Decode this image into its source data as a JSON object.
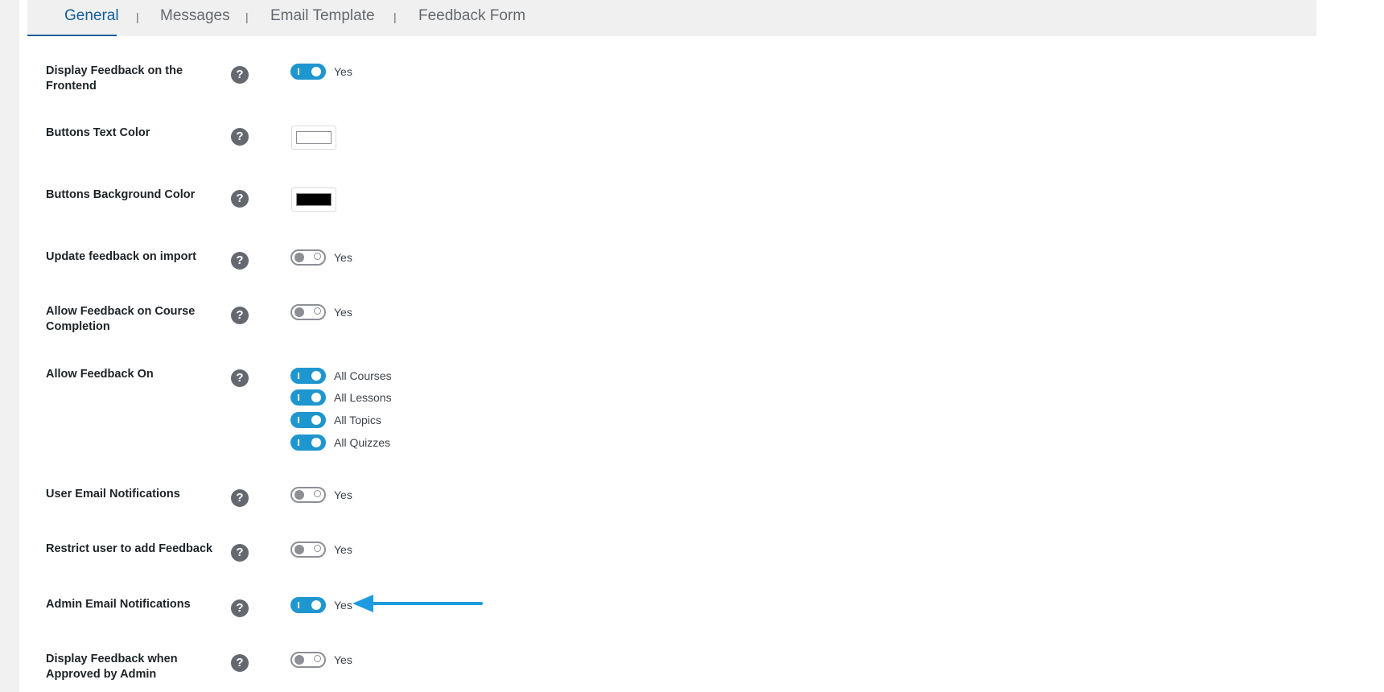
{
  "tabs": [
    {
      "label": "General",
      "active": true
    },
    {
      "label": "Messages",
      "active": false
    },
    {
      "label": "Email Template",
      "active": false
    },
    {
      "label": "Feedback Form",
      "active": false
    }
  ],
  "tab_separator": "|",
  "help_glyph": "?",
  "settings": {
    "display_feedback_frontend": {
      "label": "Display Feedback on the Frontend",
      "option": "Yes",
      "enabled": true
    },
    "buttons_text_color": {
      "label": "Buttons Text Color",
      "color": "#ffffff"
    },
    "buttons_background_color": {
      "label": "Buttons Background Color",
      "color": "#000000"
    },
    "update_feedback_import": {
      "label": "Update feedback on import",
      "option": "Yes",
      "enabled": false
    },
    "allow_feedback_course_completion": {
      "label": "Allow Feedback on Course Completion",
      "option": "Yes",
      "enabled": false
    },
    "allow_feedback_on": {
      "label": "Allow Feedback On",
      "options": [
        {
          "label": "All Courses",
          "enabled": true
        },
        {
          "label": "All Lessons",
          "enabled": true
        },
        {
          "label": "All Topics",
          "enabled": true
        },
        {
          "label": "All Quizzes",
          "enabled": true
        }
      ]
    },
    "user_email_notifications": {
      "label": "User Email Notifications",
      "option": "Yes",
      "enabled": false
    },
    "restrict_user_add_feedback": {
      "label": "Restrict user to add Feedback",
      "option": "Yes",
      "enabled": false
    },
    "admin_email_notifications": {
      "label": "Admin Email Notifications",
      "option": "Yes",
      "enabled": true
    },
    "display_feedback_approved": {
      "label": "Display Feedback when Approved by Admin",
      "option": "Yes",
      "enabled": false
    }
  },
  "colors": {
    "accent": "#1e96cf",
    "active_tab": "#135e96",
    "annotation_arrow": "#1e9be0"
  }
}
